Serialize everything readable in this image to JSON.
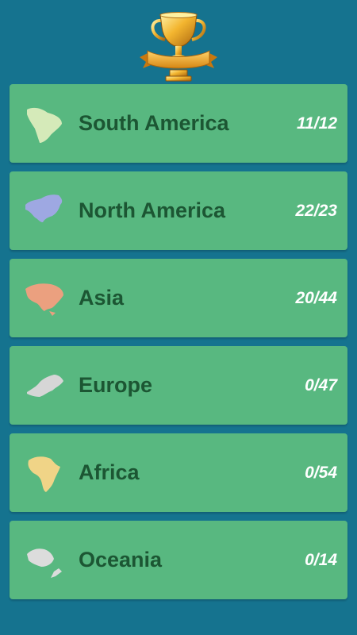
{
  "header": {
    "icon": "trophy-icon"
  },
  "continents": [
    {
      "id": "south-america",
      "name": "South America",
      "score": "11/12",
      "completed": 11,
      "total": 12,
      "icon": "south-america-map-icon",
      "map_color": "#d5eab9"
    },
    {
      "id": "north-america",
      "name": "North America",
      "score": "22/23",
      "completed": 22,
      "total": 23,
      "icon": "north-america-map-icon",
      "map_color": "#9ea8e2"
    },
    {
      "id": "asia",
      "name": "Asia",
      "score": "20/44",
      "completed": 20,
      "total": 44,
      "icon": "asia-map-icon",
      "map_color": "#eba07f"
    },
    {
      "id": "europe",
      "name": "Europe",
      "score": "0/47",
      "completed": 0,
      "total": 47,
      "icon": "europe-map-icon",
      "map_color": "#d6d6d6"
    },
    {
      "id": "africa",
      "name": "Africa",
      "score": "0/54",
      "completed": 0,
      "total": 54,
      "icon": "africa-map-icon",
      "map_color": "#f0d487"
    },
    {
      "id": "oceania",
      "name": "Oceania",
      "score": "0/14",
      "completed": 0,
      "total": 14,
      "icon": "oceania-map-icon",
      "map_color": "#dcdcdc"
    }
  ],
  "colors": {
    "background": "#15738f",
    "card": "#58b880",
    "name_text": "#1c5633",
    "score_text": "#ffffff"
  }
}
